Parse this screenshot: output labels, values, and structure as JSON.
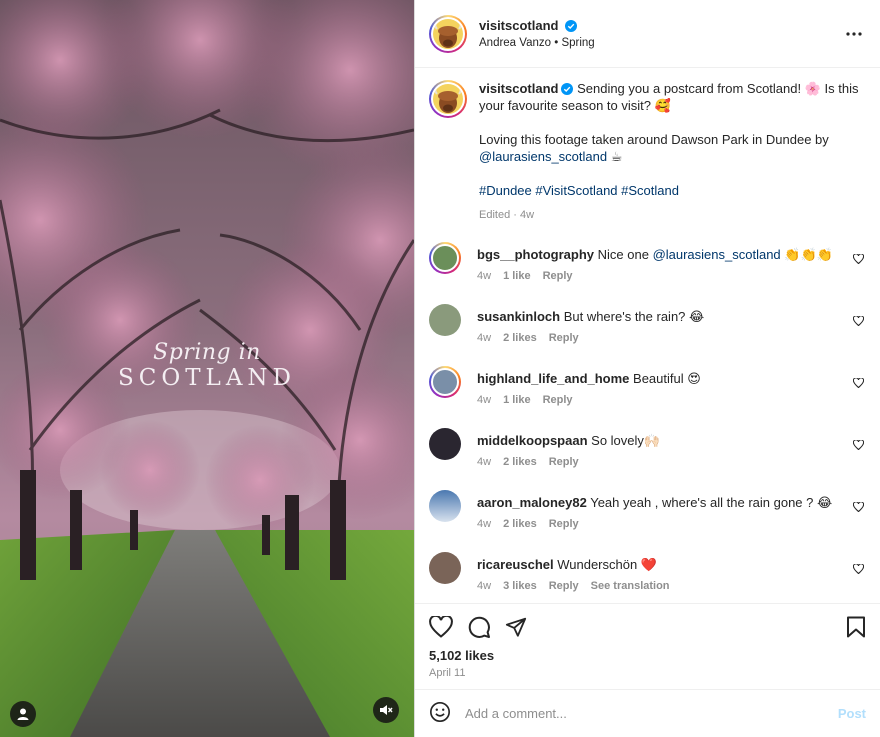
{
  "media": {
    "overlay_line1": "Spring in",
    "overlay_line2": "SCOTLAND",
    "left_icon": "user-tag-icon",
    "right_icon": "mute-icon"
  },
  "header": {
    "username": "visitscotland",
    "subtitle": "Andrea Vanzo • Spring",
    "more_icon": "more-options-icon"
  },
  "caption": {
    "username": "visitscotland",
    "line1": " Sending you a postcard from Scotland! 🌸 Is this your favourite season to visit? 🥰",
    "line2_prefix": "Loving this footage taken around Dawson Park in Dundee by ",
    "mention": "@laurasiens_scotland",
    "line2_suffix": " ☕",
    "hashtags": "#Dundee #VisitScotland #Scotland",
    "meta": "Edited · 4w"
  },
  "comments": [
    {
      "user": "bgs__photography",
      "text": " Nice one ",
      "mention": "@laurasiens_scotland",
      "after": " 👏👏👏",
      "age": "4w",
      "likes": "1 like",
      "reply": "Reply",
      "extra": ""
    },
    {
      "user": "susankinloch",
      "text": " But where's the rain? 😂",
      "mention": "",
      "after": "",
      "age": "4w",
      "likes": "2 likes",
      "reply": "Reply",
      "extra": ""
    },
    {
      "user": "highland_life_and_home",
      "text": " Beautiful 😍",
      "mention": "",
      "after": "",
      "age": "4w",
      "likes": "1 like",
      "reply": "Reply",
      "extra": ""
    },
    {
      "user": "middelkoopspaan",
      "text": " So lovely🙌🏻",
      "mention": "",
      "after": "",
      "age": "4w",
      "likes": "2 likes",
      "reply": "Reply",
      "extra": ""
    },
    {
      "user": "aaron_maloney82",
      "text": " Yeah yeah , where's all the rain gone ? 😂",
      "mention": "",
      "after": "",
      "age": "4w",
      "likes": "2 likes",
      "reply": "Reply",
      "extra": ""
    },
    {
      "user": "ricareuschel",
      "text": " Wunderschön ❤️",
      "mention": "",
      "after": "",
      "age": "4w",
      "likes": "3 likes",
      "reply": "Reply",
      "extra": "See translation"
    }
  ],
  "actions": {
    "likes": "5,102 likes",
    "date": "April 11"
  },
  "add_comment": {
    "placeholder": "Add a comment...",
    "post": "Post"
  },
  "colors": {
    "accent_blue": "#0095f6",
    "link": "#00376b",
    "muted": "#8e8e8e"
  }
}
